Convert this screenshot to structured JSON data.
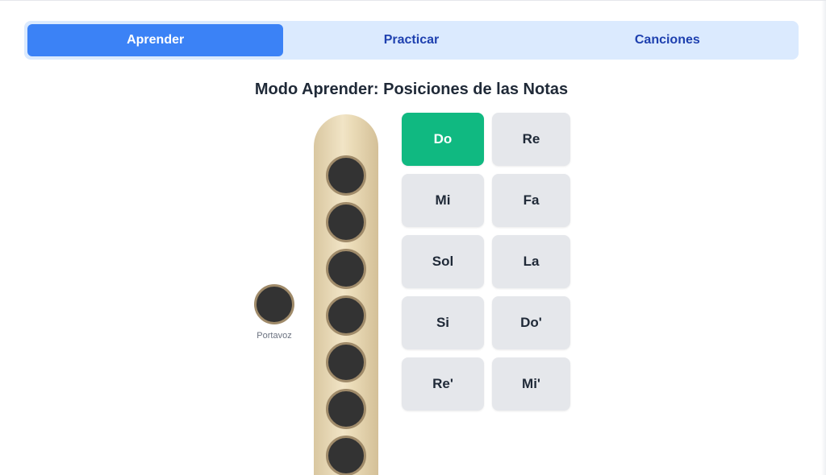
{
  "tabs": [
    {
      "label": "Aprender",
      "active": true
    },
    {
      "label": "Practicar",
      "active": false
    },
    {
      "label": "Canciones",
      "active": false
    }
  ],
  "learn": {
    "title": "Modo Aprender: Posiciones de las Notas",
    "mouthpiece_label": "Portavoz",
    "notes": [
      {
        "label": "Do",
        "active": true
      },
      {
        "label": "Re",
        "active": false
      },
      {
        "label": "Mi",
        "active": false
      },
      {
        "label": "Fa",
        "active": false
      },
      {
        "label": "Sol",
        "active": false
      },
      {
        "label": "La",
        "active": false
      },
      {
        "label": "Si",
        "active": false
      },
      {
        "label": "Do'",
        "active": false
      },
      {
        "label": "Re'",
        "active": false
      },
      {
        "label": "Mi'",
        "active": false
      }
    ]
  },
  "colors": {
    "tab_bar": "#dbeafe",
    "tab_active": "#3b82f6",
    "tab_text": "#1e40af",
    "note_active": "#10b981",
    "note_inactive": "#e5e7eb",
    "hole_covered": "#333333",
    "hole_rim": "#a08b6a",
    "recorder_body": "#eadbb7"
  }
}
